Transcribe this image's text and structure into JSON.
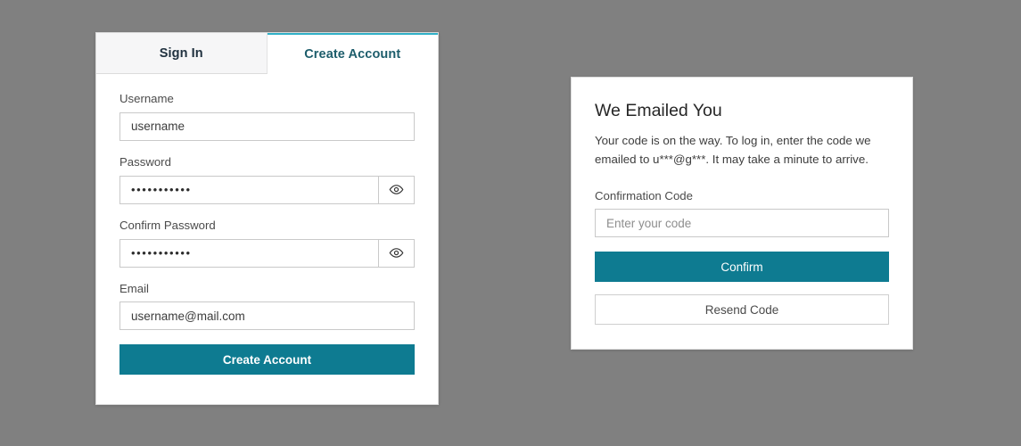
{
  "theme": {
    "page_background": "#808080",
    "accent_teal": "#0e7b91",
    "tab_indicator": "#30b0c7",
    "active_tab_text": "#1d5d6b"
  },
  "auth_card": {
    "tabs": [
      {
        "label": "Sign In",
        "active": false
      },
      {
        "label": "Create Account",
        "active": true
      }
    ],
    "fields": [
      {
        "label": "Username",
        "value": "username",
        "type": "text",
        "has_reveal": false
      },
      {
        "label": "Password",
        "value": "•••••••••••",
        "type": "password",
        "has_reveal": true,
        "reveal_icon": "eye-icon"
      },
      {
        "label": "Confirm Password",
        "value": "•••••••••••",
        "type": "password",
        "has_reveal": true,
        "reveal_icon": "eye-icon"
      },
      {
        "label": "Email",
        "value": "username@mail.com",
        "type": "email",
        "has_reveal": false
      }
    ],
    "submit_label": "Create Account"
  },
  "confirm_card": {
    "heading": "We Emailed You",
    "body": "Your code is on the way. To log in, enter the code we emailed to u***@g***. It may take a minute to arrive.",
    "masked_email": "u***@g***",
    "code_label": "Confirmation Code",
    "code_value": "",
    "code_placeholder": "Enter your code",
    "confirm_label": "Confirm",
    "resend_label": "Resend Code"
  }
}
